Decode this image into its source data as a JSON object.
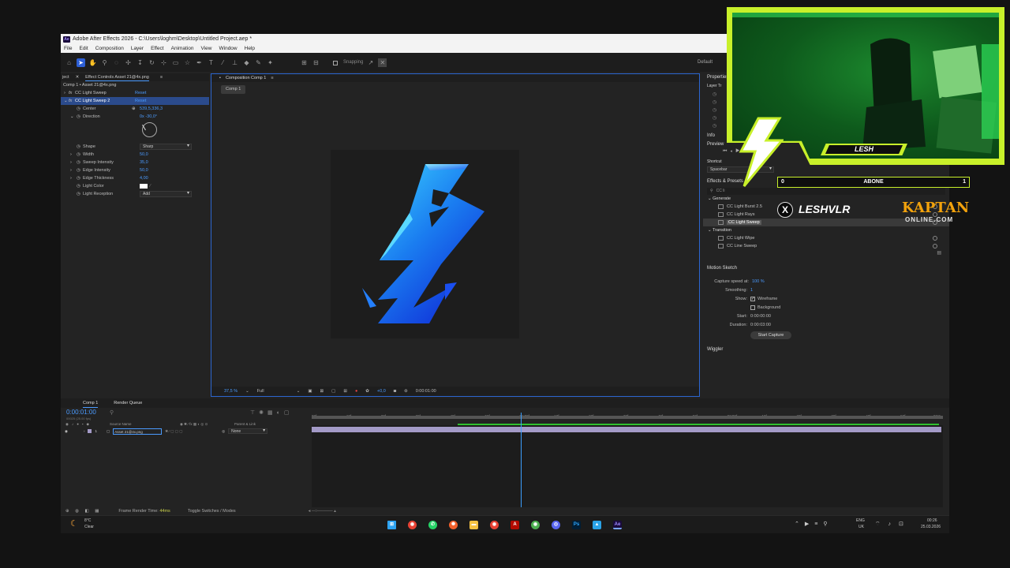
{
  "window": {
    "title": "Adobe After Effects 2026 - C:\\Users\\loghm\\Desktop\\Untitled Project.aep *",
    "logo": "Ae",
    "menu": [
      "File",
      "Edit",
      "Composition",
      "Layer",
      "Effect",
      "Animation",
      "View",
      "Window",
      "Help"
    ],
    "snapping": "Snapping",
    "workspace": "Default"
  },
  "effect_controls": {
    "tab_project": "ject",
    "tab_label": "Effect Controls Asset 21@4x.png",
    "breadcrumb": "Comp 1 • Asset 21@4x.png",
    "effects": [
      {
        "name": "CC Light Sweep",
        "reset": "Reset"
      },
      {
        "name": "CC Light Sweep 2",
        "reset": "Reset"
      }
    ],
    "params": [
      {
        "label": "Center",
        "value": "539,5,336,3"
      },
      {
        "label": "Direction",
        "value": "0x -30,0°"
      },
      {
        "label": "Shape",
        "value": "Sharp"
      },
      {
        "label": "Width",
        "value": "50,0"
      },
      {
        "label": "Sweep Intensity",
        "value": "35,0"
      },
      {
        "label": "Edge Intensity",
        "value": "50,0"
      },
      {
        "label": "Edge Thickness",
        "value": "4,00"
      },
      {
        "label": "Light Color",
        "value": ""
      },
      {
        "label": "Light Reception",
        "value": "Add"
      }
    ]
  },
  "composition": {
    "tab_label": "Composition Comp 1",
    "sub_tab": "Comp 1",
    "zoom": "37,5 %",
    "resolution": "Full",
    "exposure": "+0,0",
    "timecode": "0:00:01:00"
  },
  "right_panel": {
    "properties": "Properties",
    "layer_label": "Layer Tr",
    "info": "Info",
    "preview": "Preview",
    "shortcut_label": "Shortcut",
    "shortcut_value": "Spacebar",
    "effects_presets": "Effects & Presets",
    "search_value": "CC li",
    "groups": [
      {
        "name": "Generate",
        "items": [
          "CC Light Burst 2.5",
          "CC Light Rays",
          "CC Light Sweep"
        ]
      },
      {
        "name": "Transition",
        "items": [
          "CC Light Wipe",
          "CC Line Sweep"
        ]
      }
    ],
    "motion_sketch": {
      "title": "Motion Sketch",
      "capture_speed_label": "Capture speed at:",
      "capture_speed_value": "100 %",
      "smoothing_label": "Smoothing:",
      "smoothing_value": "1",
      "show_label": "Show:",
      "wireframe": "Wireframe",
      "background": "Background",
      "start_label": "Start:",
      "start_value": "0:00:00:00",
      "duration_label": "Duration:",
      "duration_value": "0:00:03:00",
      "button": "Start Capture"
    },
    "wiggler": "Wiggler"
  },
  "timeline": {
    "tab_comp": "Comp 1",
    "tab_render": "Render Queue",
    "timecode": "0:00:01:00",
    "frames": "00025 (25.00 fps)",
    "col_source": "Source Name",
    "col_parent": "Parent & Link",
    "layer_num": "1",
    "layer_name": "Asset 21@4x.png",
    "parent_value": "None",
    "ruler_labels": [
      "00f",
      "10f",
      "20f",
      "30f",
      "40f",
      "50f",
      "01:00f",
      "10f",
      "20f",
      "30f",
      "40f",
      "50f",
      "02:00f",
      "10f",
      "20f",
      "30f",
      "40f",
      "50f",
      "03:0"
    ],
    "frame_render_label": "Frame Render Time:",
    "frame_render_value": "44ms",
    "toggle_label": "Toggle Switches / Modes"
  },
  "taskbar": {
    "weather_temp": "8°C",
    "weather_desc": "Clear",
    "lang": "ENG",
    "region": "UK",
    "time": "00:26",
    "date": "25.03.2026"
  },
  "overlay": {
    "streamer_name": "LESH",
    "subscribe_label": "ABONE",
    "sub_left": "0",
    "sub_right": "1",
    "x_handle": "LESHVLR",
    "sponsor_top": "KAPTAN",
    "sponsor_bottom": "ONLINE.COM",
    "chair_text": "LESH"
  },
  "colors": {
    "accent_blue": "#2c66d0",
    "value_blue": "#4b9bff",
    "overlay_green": "#c8f02a",
    "layer_bar": "#a39ac7"
  }
}
